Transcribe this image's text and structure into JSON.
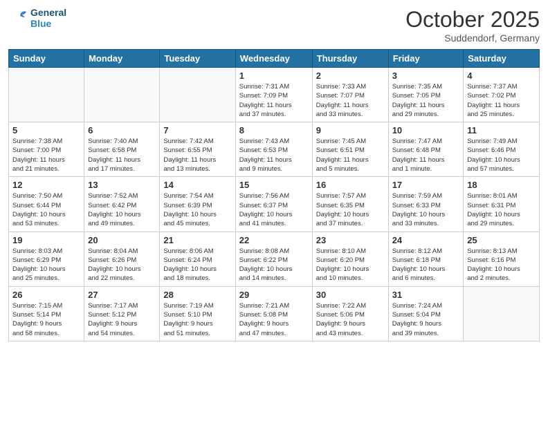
{
  "header": {
    "logo_line1": "General",
    "logo_line2": "Blue",
    "month": "October 2025",
    "location": "Suddendorf, Germany"
  },
  "weekdays": [
    "Sunday",
    "Monday",
    "Tuesday",
    "Wednesday",
    "Thursday",
    "Friday",
    "Saturday"
  ],
  "weeks": [
    [
      {
        "day": "",
        "info": ""
      },
      {
        "day": "",
        "info": ""
      },
      {
        "day": "",
        "info": ""
      },
      {
        "day": "1",
        "info": "Sunrise: 7:31 AM\nSunset: 7:09 PM\nDaylight: 11 hours\nand 37 minutes."
      },
      {
        "day": "2",
        "info": "Sunrise: 7:33 AM\nSunset: 7:07 PM\nDaylight: 11 hours\nand 33 minutes."
      },
      {
        "day": "3",
        "info": "Sunrise: 7:35 AM\nSunset: 7:05 PM\nDaylight: 11 hours\nand 29 minutes."
      },
      {
        "day": "4",
        "info": "Sunrise: 7:37 AM\nSunset: 7:02 PM\nDaylight: 11 hours\nand 25 minutes."
      }
    ],
    [
      {
        "day": "5",
        "info": "Sunrise: 7:38 AM\nSunset: 7:00 PM\nDaylight: 11 hours\nand 21 minutes."
      },
      {
        "day": "6",
        "info": "Sunrise: 7:40 AM\nSunset: 6:58 PM\nDaylight: 11 hours\nand 17 minutes."
      },
      {
        "day": "7",
        "info": "Sunrise: 7:42 AM\nSunset: 6:55 PM\nDaylight: 11 hours\nand 13 minutes."
      },
      {
        "day": "8",
        "info": "Sunrise: 7:43 AM\nSunset: 6:53 PM\nDaylight: 11 hours\nand 9 minutes."
      },
      {
        "day": "9",
        "info": "Sunrise: 7:45 AM\nSunset: 6:51 PM\nDaylight: 11 hours\nand 5 minutes."
      },
      {
        "day": "10",
        "info": "Sunrise: 7:47 AM\nSunset: 6:48 PM\nDaylight: 11 hours\nand 1 minute."
      },
      {
        "day": "11",
        "info": "Sunrise: 7:49 AM\nSunset: 6:46 PM\nDaylight: 10 hours\nand 57 minutes."
      }
    ],
    [
      {
        "day": "12",
        "info": "Sunrise: 7:50 AM\nSunset: 6:44 PM\nDaylight: 10 hours\nand 53 minutes."
      },
      {
        "day": "13",
        "info": "Sunrise: 7:52 AM\nSunset: 6:42 PM\nDaylight: 10 hours\nand 49 minutes."
      },
      {
        "day": "14",
        "info": "Sunrise: 7:54 AM\nSunset: 6:39 PM\nDaylight: 10 hours\nand 45 minutes."
      },
      {
        "day": "15",
        "info": "Sunrise: 7:56 AM\nSunset: 6:37 PM\nDaylight: 10 hours\nand 41 minutes."
      },
      {
        "day": "16",
        "info": "Sunrise: 7:57 AM\nSunset: 6:35 PM\nDaylight: 10 hours\nand 37 minutes."
      },
      {
        "day": "17",
        "info": "Sunrise: 7:59 AM\nSunset: 6:33 PM\nDaylight: 10 hours\nand 33 minutes."
      },
      {
        "day": "18",
        "info": "Sunrise: 8:01 AM\nSunset: 6:31 PM\nDaylight: 10 hours\nand 29 minutes."
      }
    ],
    [
      {
        "day": "19",
        "info": "Sunrise: 8:03 AM\nSunset: 6:29 PM\nDaylight: 10 hours\nand 25 minutes."
      },
      {
        "day": "20",
        "info": "Sunrise: 8:04 AM\nSunset: 6:26 PM\nDaylight: 10 hours\nand 22 minutes."
      },
      {
        "day": "21",
        "info": "Sunrise: 8:06 AM\nSunset: 6:24 PM\nDaylight: 10 hours\nand 18 minutes."
      },
      {
        "day": "22",
        "info": "Sunrise: 8:08 AM\nSunset: 6:22 PM\nDaylight: 10 hours\nand 14 minutes."
      },
      {
        "day": "23",
        "info": "Sunrise: 8:10 AM\nSunset: 6:20 PM\nDaylight: 10 hours\nand 10 minutes."
      },
      {
        "day": "24",
        "info": "Sunrise: 8:12 AM\nSunset: 6:18 PM\nDaylight: 10 hours\nand 6 minutes."
      },
      {
        "day": "25",
        "info": "Sunrise: 8:13 AM\nSunset: 6:16 PM\nDaylight: 10 hours\nand 2 minutes."
      }
    ],
    [
      {
        "day": "26",
        "info": "Sunrise: 7:15 AM\nSunset: 5:14 PM\nDaylight: 9 hours\nand 58 minutes."
      },
      {
        "day": "27",
        "info": "Sunrise: 7:17 AM\nSunset: 5:12 PM\nDaylight: 9 hours\nand 54 minutes."
      },
      {
        "day": "28",
        "info": "Sunrise: 7:19 AM\nSunset: 5:10 PM\nDaylight: 9 hours\nand 51 minutes."
      },
      {
        "day": "29",
        "info": "Sunrise: 7:21 AM\nSunset: 5:08 PM\nDaylight: 9 hours\nand 47 minutes."
      },
      {
        "day": "30",
        "info": "Sunrise: 7:22 AM\nSunset: 5:06 PM\nDaylight: 9 hours\nand 43 minutes."
      },
      {
        "day": "31",
        "info": "Sunrise: 7:24 AM\nSunset: 5:04 PM\nDaylight: 9 hours\nand 39 minutes."
      },
      {
        "day": "",
        "info": ""
      }
    ]
  ]
}
